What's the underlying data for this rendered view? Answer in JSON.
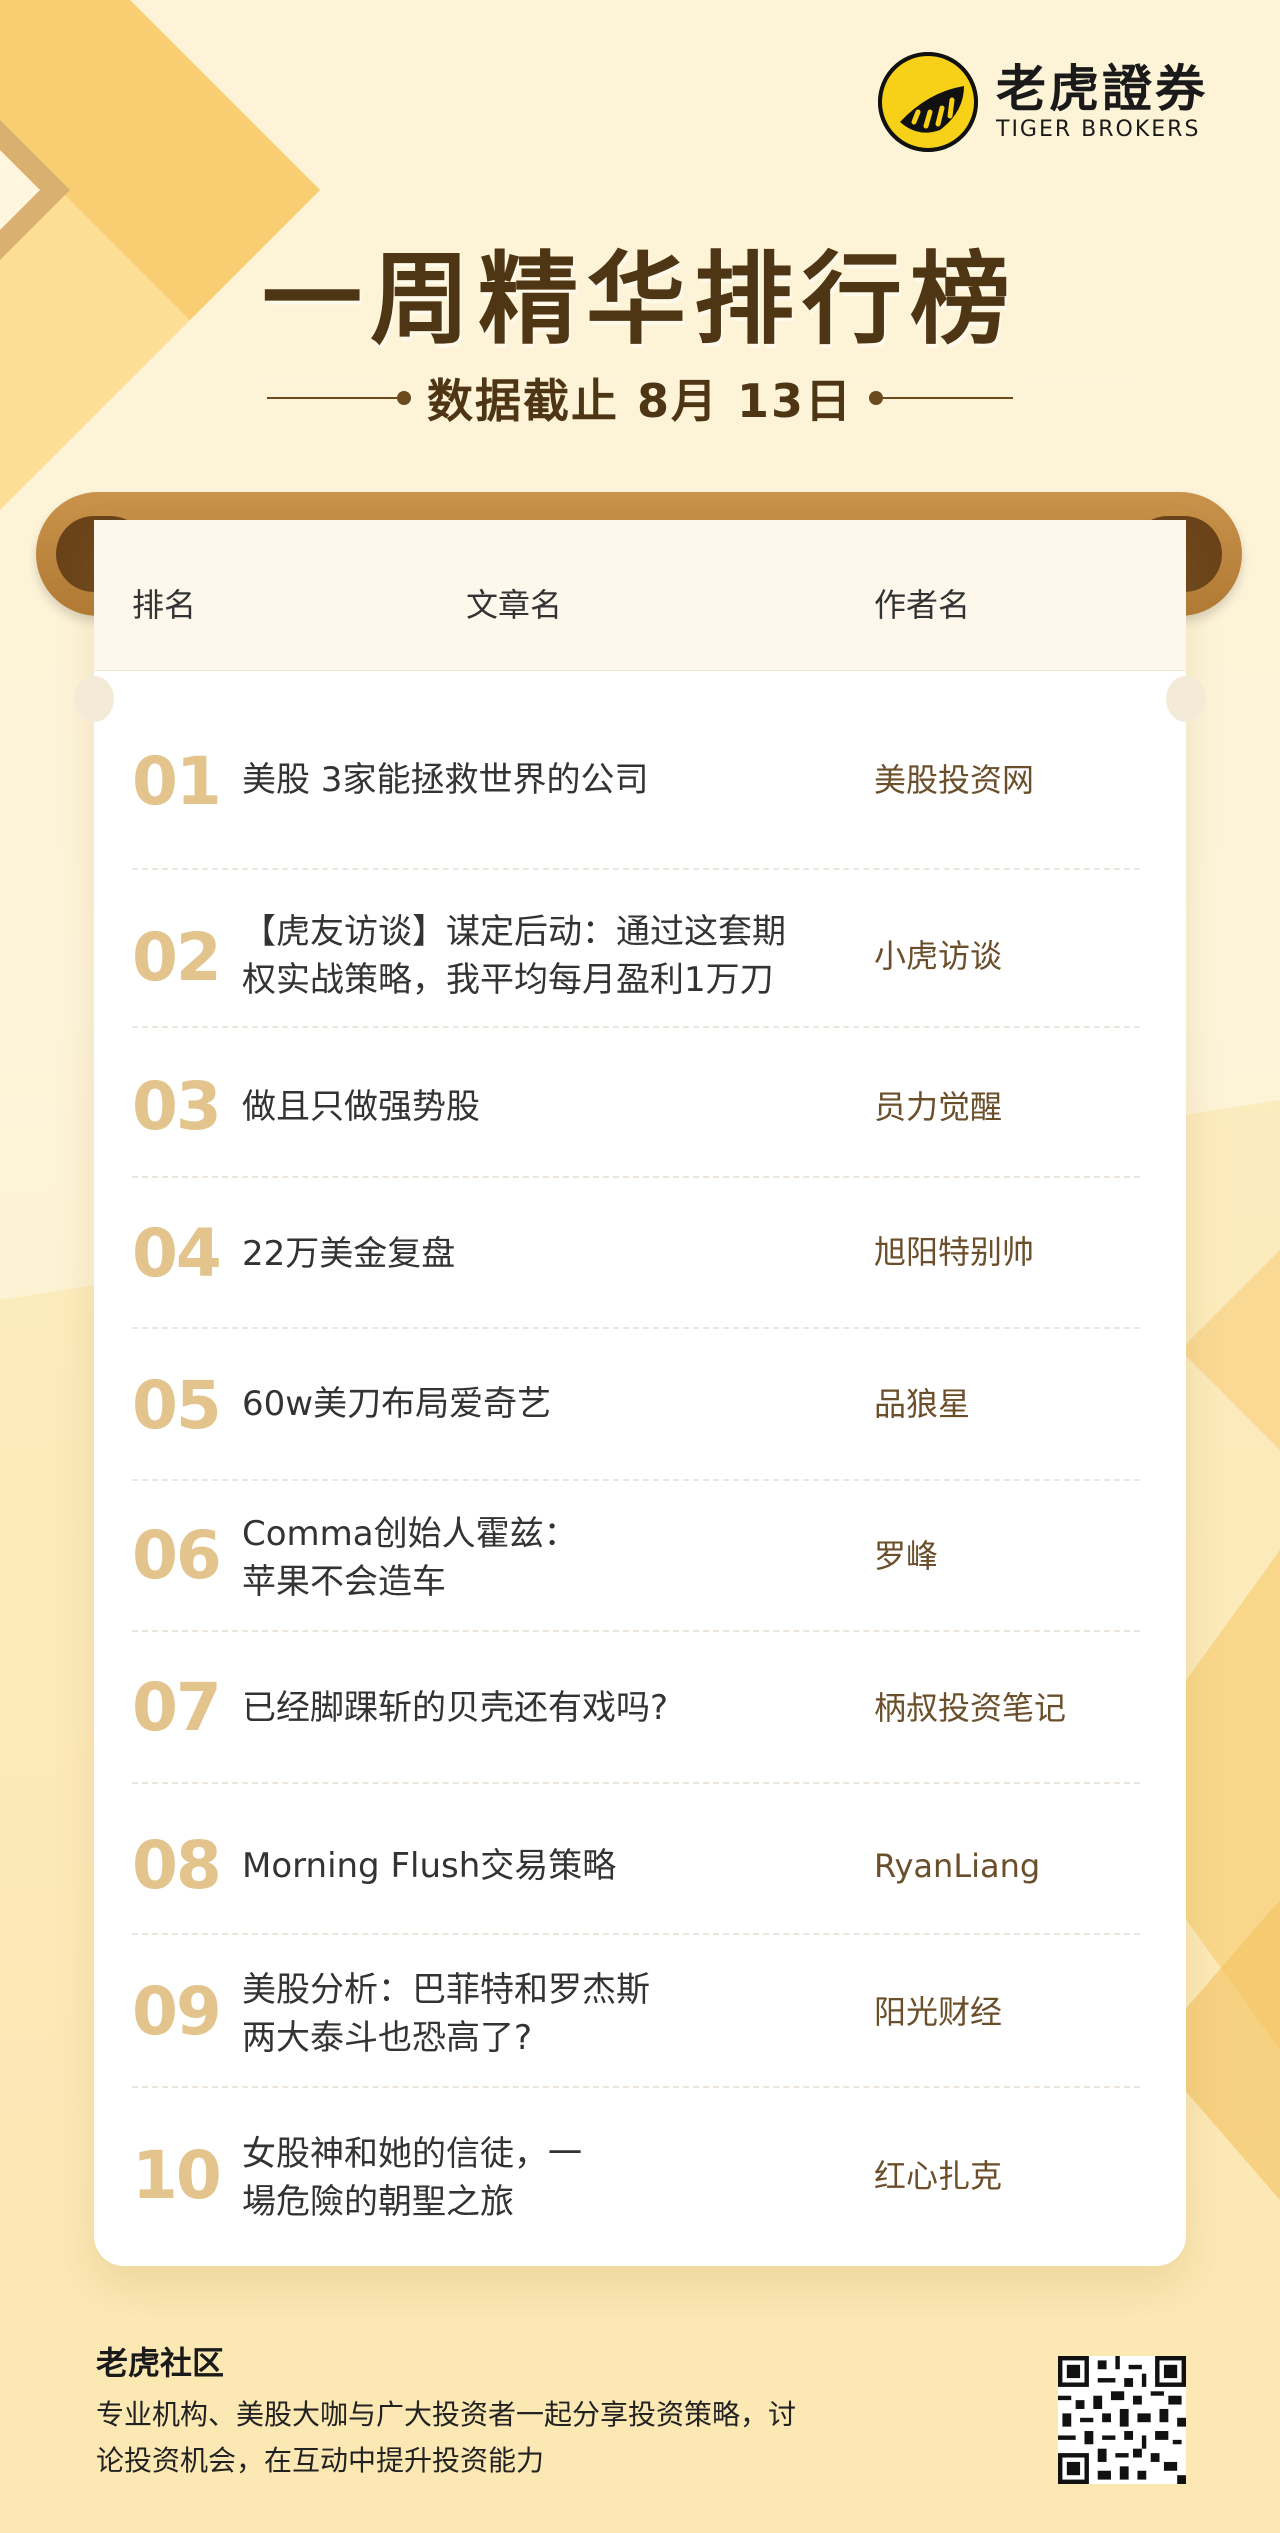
{
  "brand": {
    "name_cn": "老虎證券",
    "name_en": "TIGER BROKERS"
  },
  "title": "一周精华排行榜",
  "subtitle": "数据截止 8月 13日",
  "table": {
    "headers": {
      "rank": "排名",
      "article": "文章名",
      "author": "作者名"
    },
    "rows": [
      {
        "rank": "01",
        "article": "美股 3家能拯救世界的公司",
        "author": "美股投资网"
      },
      {
        "rank": "02",
        "article": "【虎友访谈】谋定后动：通过这套期权实战策略，我平均每月盈利1万刀",
        "author": "小虎访谈"
      },
      {
        "rank": "03",
        "article": "做且只做强势股",
        "author": "员力觉醒"
      },
      {
        "rank": "04",
        "article": "22万美金复盘",
        "author": "旭阳特别帅"
      },
      {
        "rank": "05",
        "article": "60w美刀布局爱奇艺",
        "author": "品狼星"
      },
      {
        "rank": "06",
        "article": "Comma创始人霍兹：苹果不会造车",
        "author": "罗峰"
      },
      {
        "rank": "07",
        "article": "已经脚踝斩的贝壳还有戏吗?",
        "author": "柄叔投资笔记"
      },
      {
        "rank": "08",
        "article": "Morning Flush交易策略",
        "author": "RyanLiang"
      },
      {
        "rank": "09",
        "article": "美股分析：巴菲特和罗杰斯两大泰斗也恐高了?",
        "author": "阳光财经"
      },
      {
        "rank": "10",
        "article": "女股神和她的信徒，一場危險的朝聖之旅",
        "author": "红心扎克"
      }
    ]
  },
  "footer": {
    "title": "老虎社区",
    "description": "专业机构、美股大咖与广大投资者一起分享投资策略，讨论投资机会，在互动中提升投资能力"
  },
  "colors": {
    "accent_gold": "#e2c48c",
    "title_brown": "#4e3513",
    "logo_yellow": "#f7d117"
  }
}
